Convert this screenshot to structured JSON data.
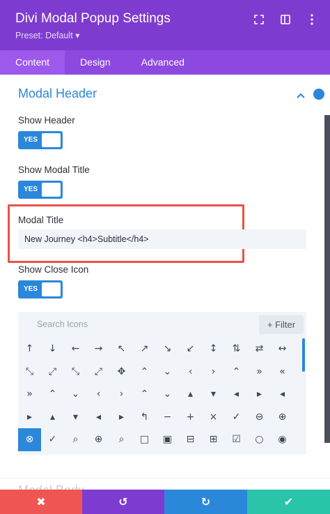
{
  "header": {
    "title": "Divi Modal Popup Settings",
    "preset": "Preset: Default ▾",
    "icons": [
      "expand-icon",
      "sidebar-layout-icon",
      "more-vertical-icon"
    ]
  },
  "tabs": [
    {
      "label": "Content",
      "active": true
    },
    {
      "label": "Design",
      "active": false
    },
    {
      "label": "Advanced",
      "active": false
    }
  ],
  "section": {
    "title": "Modal Header",
    "next_title": "Modal Body"
  },
  "fields": {
    "show_header": {
      "label": "Show Header",
      "toggle": "YES"
    },
    "show_modal_title": {
      "label": "Show Modal Title",
      "toggle": "YES"
    },
    "modal_title": {
      "label": "Modal Title",
      "value": "New Journey <h4>Subtitle</h4>"
    },
    "show_close_icon": {
      "label": "Show Close Icon",
      "toggle": "YES"
    }
  },
  "icon_picker": {
    "search_placeholder": "Search Icons",
    "filter_label": "+ Filter",
    "selected_index": 48,
    "icons": [
      "↑",
      "↓",
      "←",
      "→",
      "↖",
      "↗",
      "↘",
      "↙",
      "↕",
      "⇅",
      "⇄",
      "↔",
      "⤡",
      "⤢",
      "⤡",
      "⤢",
      "✥",
      "⌃",
      "⌄",
      "‹",
      "›",
      "⌃",
      "»",
      "«",
      "»",
      "⌃",
      "⌄",
      "‹",
      "›",
      "⌃",
      "⌄",
      "▴",
      "▾",
      "◂",
      "▸",
      "◂",
      "▸",
      "▴",
      "▾",
      "◂",
      "▸",
      "↰",
      "−",
      "+",
      "×",
      "✓",
      "⊖",
      "⊕",
      "⊗",
      "✓",
      "⌕",
      "⊕",
      "⌕",
      "□",
      "▣",
      "⊟",
      "⊞",
      "☑",
      "○",
      "◉"
    ]
  },
  "footer": {
    "cancel": "✖",
    "undo": "↺",
    "redo": "↻",
    "save": "✔"
  },
  "colors": {
    "header": "#7e3bd0",
    "accent_blue": "#2b87da",
    "highlight_red": "#e8524a",
    "save_green": "#29c4a9"
  }
}
